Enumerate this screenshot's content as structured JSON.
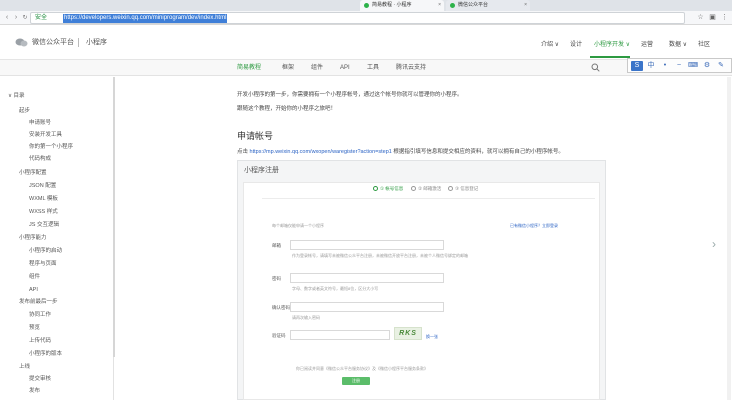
{
  "browser": {
    "tabs": [
      {
        "label": "简易教程 · 小程序",
        "active": true
      },
      {
        "label": "微信公众平台",
        "active": false
      }
    ],
    "close_glyph": "×",
    "secure_label": "安全",
    "url": "https://developers.weixin.qq.com/miniprogram/dev/index.html"
  },
  "header": {
    "brand": "微信公众平台",
    "product": "小程序",
    "nav": [
      {
        "label": "介绍 ∨",
        "active": false
      },
      {
        "label": "设计",
        "active": false
      },
      {
        "label": "小程序开发 ∨",
        "active": true
      },
      {
        "label": "运营",
        "active": false
      },
      {
        "label": "数据 ∨",
        "active": false
      },
      {
        "label": "社区",
        "active": false
      }
    ]
  },
  "subnav": {
    "items": [
      {
        "label": "简易教程",
        "active": true
      },
      {
        "label": "框架",
        "active": false
      },
      {
        "label": "组件",
        "active": false
      },
      {
        "label": "API",
        "active": false
      },
      {
        "label": "工具",
        "active": false
      },
      {
        "label": "腾讯云支持",
        "active": false
      }
    ]
  },
  "toolbar": {
    "items": [
      "S",
      "中",
      "•",
      "~",
      "⌨",
      "⚙",
      "✎"
    ]
  },
  "sidebar": {
    "items": [
      {
        "label": "∨  目录",
        "level": 0
      },
      {
        "label": "起步",
        "level": 1
      },
      {
        "label": "申请账号",
        "level": 2
      },
      {
        "label": "安装开发工具",
        "level": 2
      },
      {
        "label": "你的第一个小程序",
        "level": 2
      },
      {
        "label": "代码构成",
        "level": 2
      },
      {
        "label": "小程序配置",
        "level": 1
      },
      {
        "label": "JSON 配置",
        "level": 2
      },
      {
        "label": "WXML 模板",
        "level": 2
      },
      {
        "label": "WXSS 样式",
        "level": 2
      },
      {
        "label": "JS 交互逻辑",
        "level": 2
      },
      {
        "label": "小程序能力",
        "level": 1
      },
      {
        "label": "小程序的启动",
        "level": 2
      },
      {
        "label": "程序与页面",
        "level": 2
      },
      {
        "label": "组件",
        "level": 2
      },
      {
        "label": "API",
        "level": 2
      },
      {
        "label": "发布前最后一步",
        "level": 1
      },
      {
        "label": "协同工作",
        "level": 2
      },
      {
        "label": "预览",
        "level": 2
      },
      {
        "label": "上传代码",
        "level": 2
      },
      {
        "label": "小程序的版本",
        "level": 2
      },
      {
        "label": "上线",
        "level": 1
      },
      {
        "label": "提交审核",
        "level": 2
      },
      {
        "label": "发布",
        "level": 2
      }
    ]
  },
  "main": {
    "intro1": "开发小程序的第一步，你需要拥有一个小程序帐号，通过这个帐号你就可以管理你的小程序。",
    "intro2": "跟随这个教程，开始你的小程序之旅吧！",
    "signup_heading": "申请帐号",
    "signup_text_prefix": "点击 ",
    "signup_link": "https://mp.weixin.qq.com/wxopen/waregister?action=step1",
    "signup_text_suffix": " 根据指引填写信息和提交相应的资料，就可以拥有自己的小程序帐号。",
    "next_arrow": "›"
  },
  "register_form": {
    "title": "小程序注册",
    "steps": [
      "① 帐号信息",
      "② 邮箱激活",
      "③ 信息登记"
    ],
    "top_left": "每个邮箱仅能申请一个小程序",
    "top_right": "已有微信小程序？立即登录",
    "fields": [
      {
        "label": "邮箱",
        "hint": "作为登录帐号，请填写未被微信公众平台注册，未被微信开放平台注册，未被个人微信号绑定的邮箱"
      },
      {
        "label": "密码",
        "hint": "字母、数字或者英文符号，最短8位，区分大小写"
      },
      {
        "label": "确认密码",
        "hint": "请再次输入密码"
      },
      {
        "label": "验证码",
        "hint": ""
      }
    ],
    "captcha_text": "RKS",
    "captcha_refresh": "换一张",
    "agreement": "你已阅读并同意《微信公众平台服务协议》及《微信小程序平台服务条款》",
    "submit_label": "注册"
  }
}
